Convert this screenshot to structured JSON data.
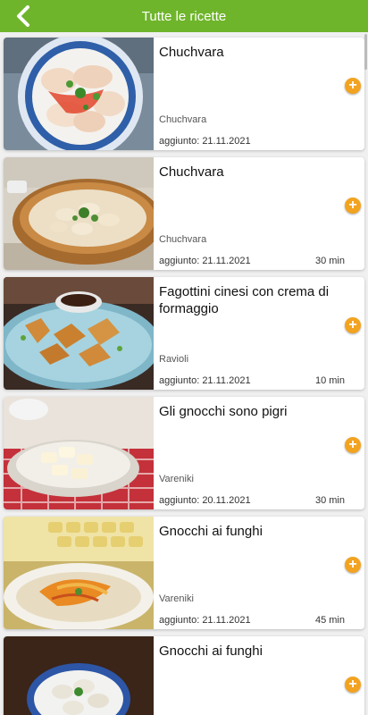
{
  "header": {
    "title": "Tutte le ricette",
    "back_icon": "chevron-left-icon"
  },
  "colors": {
    "appbar": "#6fb52b",
    "add_button": "#f2a320"
  },
  "recipes": [
    {
      "title": "Chuchvara",
      "category": "Chuchvara",
      "date": "aggiunto: 21.11.2021",
      "time": ""
    },
    {
      "title": "Chuchvara",
      "category": "Chuchvara",
      "date": "aggiunto: 21.11.2021",
      "time": "30 min"
    },
    {
      "title": "Fagottini cinesi con crema di formaggio",
      "category": "Ravioli",
      "date": "aggiunto: 21.11.2021",
      "time": "10 min"
    },
    {
      "title": "Gli gnocchi sono pigri",
      "category": "Vareniki",
      "date": "aggiunto: 20.11.2021",
      "time": "30 min"
    },
    {
      "title": "Gnocchi ai funghi",
      "category": "Vareniki",
      "date": "aggiunto: 21.11.2021",
      "time": "45 min"
    },
    {
      "title": "Gnocchi ai funghi",
      "category": "",
      "date": "",
      "time": ""
    }
  ]
}
